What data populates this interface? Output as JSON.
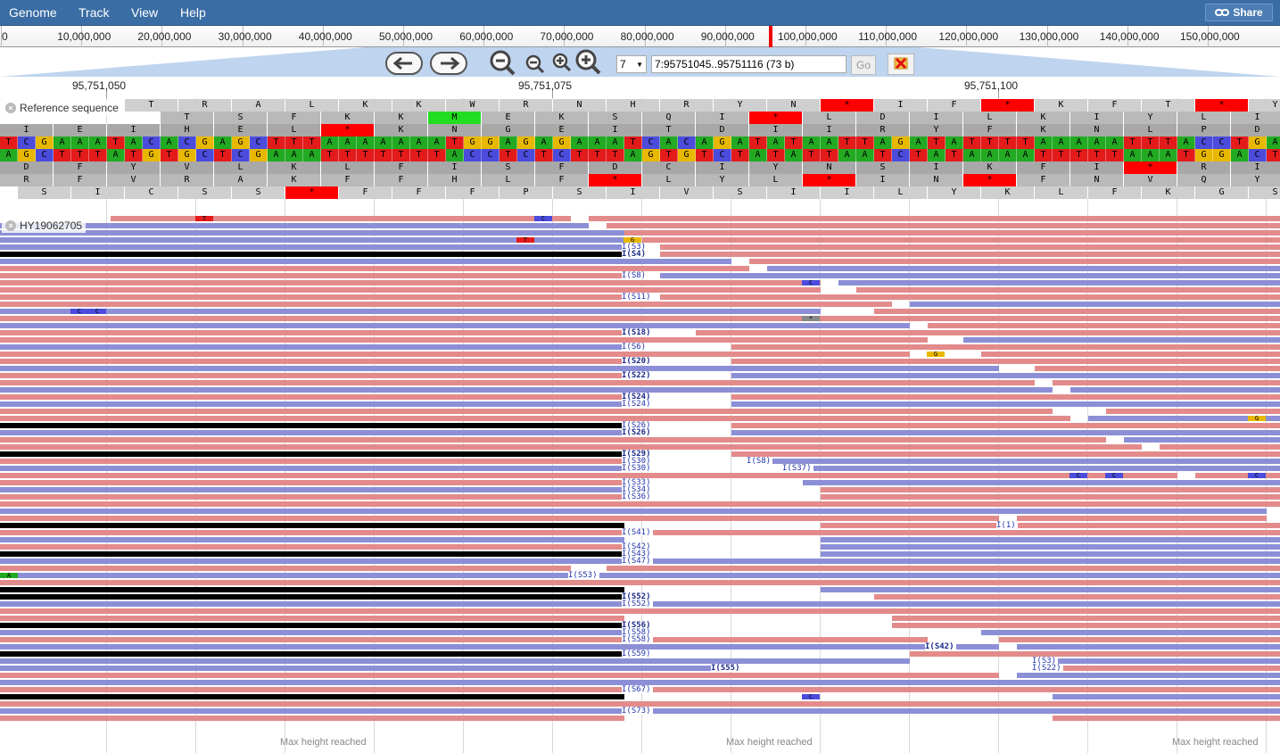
{
  "menu": {
    "items": [
      "Genome",
      "Track",
      "View",
      "Help"
    ],
    "share_label": "Share"
  },
  "overview": {
    "ticks": [
      "0",
      "10,000,000",
      "20,000,000",
      "30,000,000",
      "40,000,000",
      "50,000,000",
      "60,000,000",
      "70,000,000",
      "80,000,000",
      "90,000,000",
      "100,000,000",
      "110,000,000",
      "120,000,000",
      "130,000,000",
      "140,000,000",
      "150,000,000"
    ]
  },
  "navigation": {
    "chromosome": "7",
    "location": "7:95751045..95751116 (73 b)",
    "go_label": "Go"
  },
  "detail_ruler": {
    "ticks": [
      "95,751,050",
      "95,751,075",
      "95,751,100"
    ]
  },
  "reference_track": {
    "label": "Reference sequence",
    "frames_forward": [
      "T R A L K K W R N H R Y N * I F * K F T * Y",
      "T S F K K M E K S Q I * L D I L K I Y L I",
      "I E I H E L * K N G E I T D I I R Y F K N L P D"
    ],
    "forward_bases": "TCGAAATACACGAGCTTTAAAAAAATGGAGAGAAATCACAGATATAATTAGATATTTTAAAAATTTACCTGATA",
    "reverse_bases": "AGCTTTATGTGCTCGAAATTTTTTTACCTCTCTTTAGTGTCTATATTAATCTATAAAATTTTTAAATGGACTAT",
    "frames_reverse": [
      "D F Y V L K L F I S F D C I Y N S I K F I * R I",
      "R F V R A K F F H L F * L Y L * I N * F N V Q Y",
      "S I C S S * F F F P S I V S I I L Y K L F K G S V"
    ]
  },
  "alignment_track": {
    "label": "HY19062705",
    "max_height_text": "Max height reached",
    "softclip_labels": [
      "I(S3)",
      "I(S4)",
      "I(S8)",
      "I(S11)",
      "I(S18)",
      "I(S6)",
      "I(S20)",
      "I(S22)",
      "I(S24)",
      "I(S24)",
      "I(S26)",
      "I(S26)",
      "I(S29)",
      "I(S30)",
      "I(S30)",
      "I(S8)",
      "I(S37)",
      "I(S33)",
      "I(S34)",
      "I(S36)",
      "I(1)",
      "I(S41)",
      "I(S42)",
      "I(S43)",
      "I(S47)",
      "I(S53)",
      "I(S52)",
      "I(S52)",
      "I(S56)",
      "I(S58)",
      "I(S58)",
      "I(S42)",
      "I(S59)",
      "I(S3)",
      "I(S22)",
      "I(S55)",
      "I(S67)",
      "I(S73)"
    ],
    "mismatch_bases": [
      "T",
      "C",
      "T",
      "G",
      "C",
      "C",
      "C",
      "G",
      "C",
      "C",
      "C",
      "G",
      "A",
      "C",
      "*"
    ]
  },
  "colors": {
    "menubar": "#3a6da4",
    "forward_read": "#e38b8b",
    "reverse_read": "#8c8fd6",
    "base_A": "#22aa22",
    "base_C": "#4b4bdc",
    "base_G": "#e8b800",
    "base_T": "#e31b1b",
    "stop_codon": "#ff0000",
    "start_codon": "#22dd22"
  }
}
